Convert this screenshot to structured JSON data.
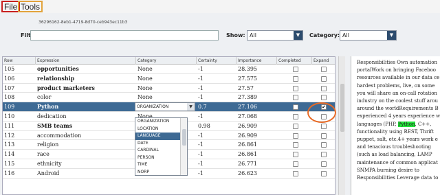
{
  "menu": {
    "file": "File",
    "tools": "Tools"
  },
  "doc_id": "36296162-8eb1-4719-8d70-ceb943ec11b3",
  "filter": {
    "label": "Filter:",
    "value": ""
  },
  "show": {
    "label": "Show:",
    "value": "All"
  },
  "category": {
    "label": "Category:",
    "value": "All"
  },
  "table": {
    "headers": [
      "Row",
      "Expression",
      "Category",
      "Certainty",
      "Importance",
      "Completed",
      "Expand"
    ],
    "rows": [
      {
        "row": "105",
        "expression": "opportunities",
        "bold": true,
        "category": "None",
        "certainty": "-1",
        "importance": "28.395"
      },
      {
        "row": "106",
        "expression": "relationship",
        "bold": true,
        "category": "None",
        "certainty": "-1",
        "importance": "27.575"
      },
      {
        "row": "107",
        "expression": "product marketers",
        "bold": true,
        "category": "None",
        "certainty": "-1",
        "importance": "27.57"
      },
      {
        "row": "108",
        "expression": "color",
        "bold": false,
        "category": "None",
        "certainty": "-1",
        "importance": "27.389"
      },
      {
        "row": "109",
        "expression": "Python",
        "bold": true,
        "category": "ORGANIZATION",
        "certainty": "0.7",
        "importance": "27.106",
        "selected": true
      },
      {
        "row": "110",
        "expression": "dedication",
        "bold": false,
        "category": "None",
        "certainty": "-1",
        "importance": "27.068"
      },
      {
        "row": "111",
        "expression": "SMB teams",
        "bold": true,
        "category": "None",
        "certainty": "0.98",
        "importance": "26.909"
      },
      {
        "row": "112",
        "expression": "accommodation",
        "bold": false,
        "category": "None",
        "certainty": "-1",
        "importance": "26.909"
      },
      {
        "row": "113",
        "expression": "religion",
        "bold": false,
        "category": "None",
        "certainty": "-1",
        "importance": "26.861"
      },
      {
        "row": "114",
        "expression": "race",
        "bold": false,
        "category": "None",
        "certainty": "-1",
        "importance": "26.861"
      },
      {
        "row": "115",
        "expression": "ethnicity",
        "bold": false,
        "category": "None",
        "certainty": "-1",
        "importance": "26.771"
      },
      {
        "row": "116",
        "expression": "Android",
        "bold": false,
        "category": "None",
        "certainty": "-1",
        "importance": "26.623"
      }
    ],
    "expand_checked_row": "109",
    "expand_checked_mark": "✔"
  },
  "category_dropdown": {
    "selected": "ORGANIZATION",
    "options": [
      "ORGANIZATION",
      "LOCATION",
      "LANGUAGE",
      "DATE",
      "CARDINAL",
      "PERSON",
      "TIME",
      "NORP"
    ],
    "highlighted": "LANGUAGE"
  },
  "text_panel": {
    "lines": [
      "Responsibilities Own automation",
      "portalWork on bringing Faceboo",
      "resources available in our data ce",
      "hardest problems, live, on some",
      "you will share an on-call rotation",
      "industry on the coolest stuff arou",
      "around the worldRequirements B",
      "experienced 4 years experience wi",
      "languages (PHP, |Python|, C++, ",
      "functionality using REST, Thrift",
      "puppet, salt, etc.4+ years work e",
      "and tenacious troubleshooting",
      "(such as load balancing, LAMP",
      "maintenance of common applicat",
      "SNMPA burning desire to",
      "Responsibilities Leverage data to"
    ]
  }
}
